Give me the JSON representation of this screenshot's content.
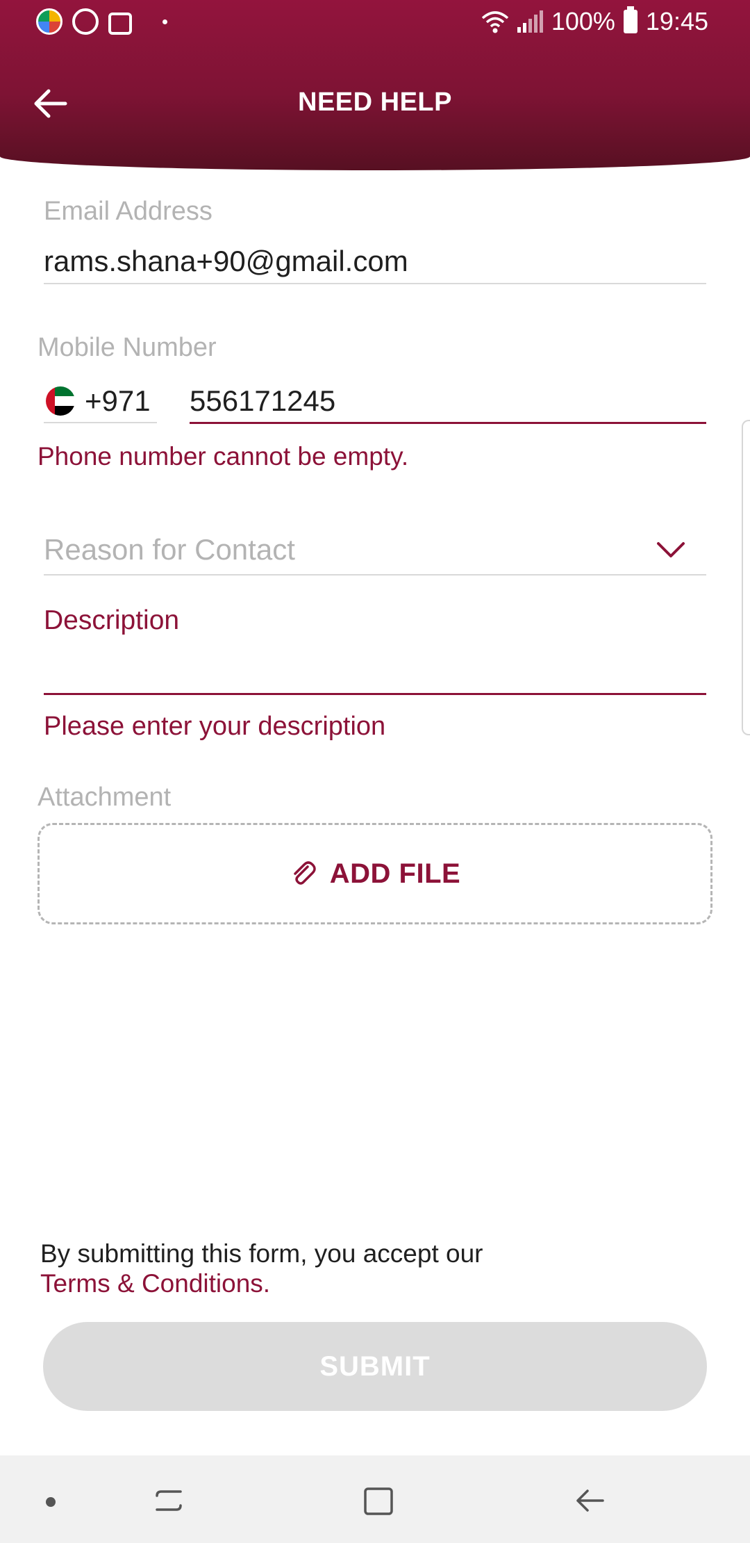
{
  "status_bar": {
    "battery": "100%",
    "time": "19:45"
  },
  "header": {
    "title": "NEED HELP"
  },
  "form": {
    "email": {
      "label": "Email Address",
      "value": "rams.shana+90@gmail.com"
    },
    "mobile": {
      "label": "Mobile Number",
      "country_code": "+971",
      "value": "556171245",
      "error": "Phone number cannot be empty."
    },
    "reason": {
      "placeholder": "Reason for Contact"
    },
    "description": {
      "label": "Description",
      "error": "Please enter your description"
    },
    "attachment": {
      "label": "Attachment",
      "button": "ADD FILE"
    }
  },
  "footer": {
    "terms_text": "By submitting this form, you accept our",
    "terms_link": "Terms & Conditions.",
    "submit": "SUBMIT"
  },
  "colors": {
    "brand": "#8c1238",
    "header_top": "#93143d",
    "header_bottom": "#571022",
    "disabled_button": "#dcdcdc"
  }
}
